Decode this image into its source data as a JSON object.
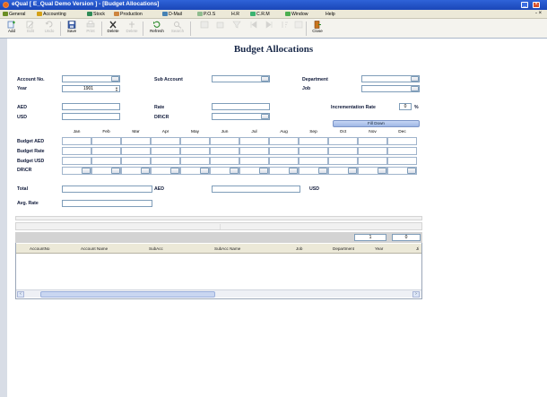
{
  "window": {
    "title": "eQual [ E_Qual Demo Version  ] - [Budget Allocations]"
  },
  "menu": {
    "items": [
      {
        "label": "General",
        "icon": "general-icon",
        "color": "#6b8e23"
      },
      {
        "label": "Accounting",
        "icon": "accounting-icon",
        "color": "#d4a017"
      },
      {
        "label": "Stock",
        "icon": "stock-icon",
        "color": "#2e8b57"
      },
      {
        "label": "Production",
        "icon": "production-icon",
        "color": "#cd853f"
      },
      {
        "label": "D-Mail",
        "icon": "dmail-icon",
        "color": "#4682b4"
      },
      {
        "label": "P.O.S",
        "icon": "pos-icon",
        "color": "#8fbc8f"
      },
      {
        "label": "H.R",
        "icon": "hr-icon",
        "color": "#ece9d8"
      },
      {
        "label": "C.R.M",
        "icon": "crm-icon",
        "color": "#3cb371"
      },
      {
        "label": "Window",
        "icon": "window-icon",
        "color": "#4caf50"
      },
      {
        "label": "Help",
        "icon": "help-icon",
        "color": "#ece9d8"
      }
    ],
    "right_symbol": "- ×"
  },
  "toolbar": {
    "buttons": [
      {
        "label": "Add",
        "enabled": true
      },
      {
        "label": "Edit",
        "enabled": false
      },
      {
        "label": "Undo",
        "enabled": false
      },
      {
        "label": "Save",
        "enabled": true
      },
      {
        "label": "Print",
        "enabled": false
      },
      {
        "label": "Delete",
        "enabled": true
      },
      {
        "label": "Delete",
        "enabled": false
      },
      {
        "label": "Refresh",
        "enabled": true
      },
      {
        "label": "Search",
        "enabled": false
      },
      {
        "label": "Close",
        "enabled": true
      }
    ]
  },
  "form": {
    "heading": "Budget Allocations",
    "account_no_label": "Account No.",
    "sub_account_label": "Sub Account",
    "department_label": "Department",
    "year_label": "Year",
    "year_value": "1901",
    "job_label": "Job",
    "aed_label": "AED",
    "rate_label": "Rate",
    "incrementation_rate_label": "Incrementation Rate",
    "incrementation_rate_value": "0",
    "percent_symbol": "%",
    "usd_label": "USD",
    "drcr_label": "DR\\CR",
    "fill_down_label": "Fill Down",
    "months": [
      "Jan",
      "Feb",
      "Mar",
      "Apr",
      "May",
      "Jun",
      "Jul",
      "Aug",
      "Sep",
      "Oct",
      "Nov",
      "Dec"
    ],
    "row_labels": [
      "Budget AED",
      "Budget Rate",
      "Budget USD",
      "DR\\CR"
    ],
    "total_label": "Total",
    "total_aed_label": "AED",
    "total_usd_label": "USD",
    "avg_rate_label": "Avg. Rate"
  },
  "grid": {
    "page_num": "1",
    "page_total": "0",
    "columns": [
      "AccountNo",
      "Account Name",
      "SubAcc",
      "SubAcc Name",
      "Job",
      "Department",
      "Year",
      "Ji"
    ]
  }
}
